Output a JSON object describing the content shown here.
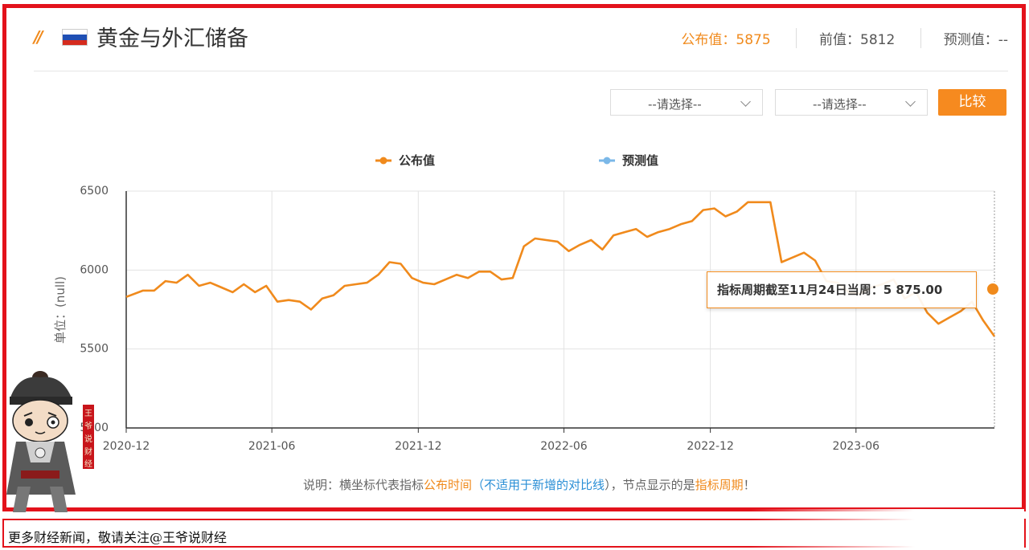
{
  "header": {
    "title": "黄金与外汇储备",
    "published_label": "公布值：5875",
    "previous_label": "前值：5812",
    "forecast_label": "预测值：--",
    "flag_icon": "russia-flag-icon",
    "accent_color": "#f08a1c"
  },
  "controls": {
    "select_1": "--请选择--",
    "select_2": "--请选择--",
    "compare_label": "比较"
  },
  "chart_data": {
    "type": "line",
    "ylabel": "单位：(null)",
    "ylim": [
      5000,
      6500
    ],
    "y_ticks": [
      "6500",
      "6000",
      "5500",
      "5000"
    ],
    "x_ticks": [
      "2020-12",
      "2021-06",
      "2021-12",
      "2022-06",
      "2022-12",
      "2023-06"
    ],
    "x_range": [
      "2020-12-04",
      "2023-11-24"
    ],
    "grid": true,
    "legend_position": "top-center",
    "series": [
      {
        "name": "公布值",
        "color": "#f08a1c",
        "points": [
          [
            "2020-12-04",
            5830
          ],
          [
            "2020-12-25",
            5870
          ],
          [
            "2021-01-08",
            5870
          ],
          [
            "2021-01-22",
            5930
          ],
          [
            "2021-02-05",
            5920
          ],
          [
            "2021-02-19",
            5970
          ],
          [
            "2021-03-05",
            5900
          ],
          [
            "2021-03-19",
            5920
          ],
          [
            "2021-04-02",
            5890
          ],
          [
            "2021-04-16",
            5860
          ],
          [
            "2021-04-30",
            5910
          ],
          [
            "2021-05-14",
            5860
          ],
          [
            "2021-05-28",
            5900
          ],
          [
            "2021-06-11",
            5800
          ],
          [
            "2021-06-25",
            5810
          ],
          [
            "2021-07-09",
            5800
          ],
          [
            "2021-07-23",
            5750
          ],
          [
            "2021-08-06",
            5820
          ],
          [
            "2021-08-20",
            5840
          ],
          [
            "2021-09-03",
            5900
          ],
          [
            "2021-09-17",
            5910
          ],
          [
            "2021-10-01",
            5920
          ],
          [
            "2021-10-15",
            5970
          ],
          [
            "2021-10-29",
            6050
          ],
          [
            "2021-11-12",
            6040
          ],
          [
            "2021-11-26",
            5950
          ],
          [
            "2021-12-10",
            5920
          ],
          [
            "2021-12-24",
            5910
          ],
          [
            "2022-01-07",
            5940
          ],
          [
            "2022-01-21",
            5970
          ],
          [
            "2022-02-04",
            5950
          ],
          [
            "2022-02-18",
            5990
          ],
          [
            "2022-03-04",
            5990
          ],
          [
            "2022-03-18",
            5940
          ],
          [
            "2022-04-01",
            5950
          ],
          [
            "2022-04-15",
            6150
          ],
          [
            "2022-04-29",
            6200
          ],
          [
            "2022-05-13",
            6190
          ],
          [
            "2022-05-27",
            6180
          ],
          [
            "2022-06-10",
            6120
          ],
          [
            "2022-06-24",
            6160
          ],
          [
            "2022-07-08",
            6190
          ],
          [
            "2022-07-22",
            6130
          ],
          [
            "2022-08-05",
            6220
          ],
          [
            "2022-08-19",
            6240
          ],
          [
            "2022-09-02",
            6260
          ],
          [
            "2022-09-16",
            6210
          ],
          [
            "2022-09-30",
            6240
          ],
          [
            "2022-10-14",
            6260
          ],
          [
            "2022-10-28",
            6290
          ],
          [
            "2022-11-11",
            6310
          ],
          [
            "2022-11-25",
            6380
          ],
          [
            "2022-12-09",
            6390
          ],
          [
            "2022-12-23",
            6340
          ],
          [
            "2023-01-06",
            6370
          ],
          [
            "2023-01-20",
            6430
          ],
          [
            "2023-02-03",
            6430
          ],
          [
            "2023-02-17",
            6430
          ],
          [
            "2023-03-03",
            6050
          ],
          [
            "2023-03-17",
            6080
          ],
          [
            "2023-03-31",
            6110
          ],
          [
            "2023-04-14",
            6060
          ],
          [
            "2023-04-28",
            5930
          ],
          [
            "2023-05-12",
            5920
          ],
          [
            "2023-05-26",
            5860
          ],
          [
            "2023-06-09",
            5850
          ],
          [
            "2023-06-23",
            5890
          ],
          [
            "2023-07-07",
            5910
          ],
          [
            "2023-07-21",
            5940
          ],
          [
            "2023-08-04",
            5820
          ],
          [
            "2023-08-18",
            5860
          ],
          [
            "2023-09-01",
            5730
          ],
          [
            "2023-09-15",
            5660
          ],
          [
            "2023-09-29",
            5700
          ],
          [
            "2023-10-13",
            5740
          ],
          [
            "2023-10-27",
            5800
          ],
          [
            "2023-11-10",
            5680
          ],
          [
            "2023-11-24",
            5580
          ]
        ]
      },
      {
        "name": "预测值",
        "color": "#7bb8e8",
        "points": []
      }
    ],
    "tooltip": "指标周期截至11月24日当周：5 875.00"
  },
  "note": {
    "prefix": "说明：横坐标代表指标",
    "orange1": "公布时间",
    "paren_open": "（",
    "blue": "不适用于新增的对比线",
    "middle": "），节点显示的是",
    "orange2": "指标周期",
    "suffix": "！"
  },
  "watermark": {
    "seal_text": "王爷说财经"
  },
  "footer": {
    "text": "更多财经新闻，敬请关注@王爷说财经"
  }
}
